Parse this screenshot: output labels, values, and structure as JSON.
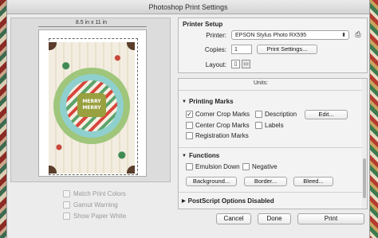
{
  "window": {
    "title": "Photoshop Print Settings"
  },
  "preview": {
    "paper_size": "8.5 in x 11 in",
    "artwork_text": "MERRY MERRY",
    "options": [
      {
        "label": "Match Print Colors",
        "checked": false,
        "enabled": false
      },
      {
        "label": "Gamut Warning",
        "checked": false,
        "enabled": false
      },
      {
        "label": "Show Paper White",
        "checked": false,
        "enabled": false
      }
    ]
  },
  "printer_setup": {
    "title": "Printer Setup",
    "printer_label": "Printer:",
    "printer_value": "EPSON Stylus Photo RX595",
    "copies_label": "Copies:",
    "copies_value": "1",
    "print_settings_button": "Print Settings...",
    "layout_label": "Layout:"
  },
  "settings": {
    "units_label": "Units:",
    "printing_marks": {
      "title": "Printing Marks",
      "corner_crop_marks": {
        "label": "Corner Crop Marks",
        "checked": true
      },
      "center_crop_marks": {
        "label": "Center Crop Marks",
        "checked": false
      },
      "registration_marks": {
        "label": "Registration Marks",
        "checked": false
      },
      "description": {
        "label": "Description",
        "checked": false
      },
      "labels": {
        "label": "Labels",
        "checked": false
      },
      "edit_button": "Edit..."
    },
    "functions": {
      "title": "Functions",
      "emulsion_down": {
        "label": "Emulsion Down",
        "checked": false
      },
      "negative": {
        "label": "Negative",
        "checked": false
      },
      "background_button": "Background...",
      "border_button": "Border...",
      "bleed_button": "Bleed..."
    },
    "postscript": {
      "title": "PostScript Options Disabled"
    }
  },
  "footer": {
    "cancel": "Cancel",
    "done": "Done",
    "print": "Print"
  },
  "icons": {
    "expanded": "triangle-down",
    "collapsed": "triangle-right",
    "check": "check-mark",
    "printer": "printer-icon"
  }
}
